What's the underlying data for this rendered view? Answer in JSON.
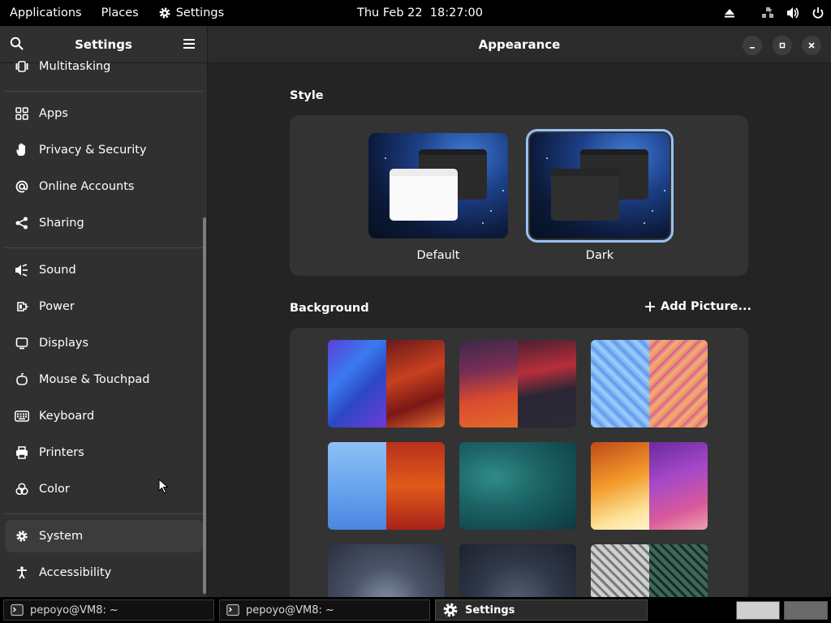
{
  "topbar": {
    "applications": "Applications",
    "places": "Places",
    "settings": "Settings",
    "clock": "Thu Feb 22  18:27:00",
    "tray_icons": [
      "eject-icon",
      "network-icon",
      "volume-icon",
      "power-icon"
    ]
  },
  "sidebar": {
    "title": "Settings",
    "items": [
      {
        "label": "Multitasking",
        "icon": "multitasking-icon"
      },
      {
        "label": "Apps",
        "icon": "apps-icon"
      },
      {
        "label": "Privacy & Security",
        "icon": "hand-icon"
      },
      {
        "label": "Online Accounts",
        "icon": "at-icon"
      },
      {
        "label": "Sharing",
        "icon": "share-icon"
      },
      {
        "label": "Sound",
        "icon": "speaker-icon"
      },
      {
        "label": "Power",
        "icon": "battery-icon"
      },
      {
        "label": "Displays",
        "icon": "display-icon"
      },
      {
        "label": "Mouse & Touchpad",
        "icon": "mouse-icon"
      },
      {
        "label": "Keyboard",
        "icon": "keyboard-icon"
      },
      {
        "label": "Printers",
        "icon": "printer-icon"
      },
      {
        "label": "Color",
        "icon": "color-icon"
      },
      {
        "label": "System",
        "icon": "gear-icon",
        "active": true
      },
      {
        "label": "Accessibility",
        "icon": "accessibility-icon"
      }
    ]
  },
  "main": {
    "title": "Appearance",
    "style_section": "Style",
    "style_options": [
      {
        "label": "Default",
        "selected": false
      },
      {
        "label": "Dark",
        "selected": true
      }
    ],
    "background_section": "Background",
    "add_picture": "Add Picture..."
  },
  "taskbar": {
    "tasks": [
      {
        "label": "pepoyo@VM8: ~"
      },
      {
        "label": "pepoyo@VM8: ~"
      },
      {
        "label": "Settings",
        "active": true
      }
    ]
  },
  "colors": {
    "accent": "#99c1f1",
    "sidebar_bg": "#303030",
    "main_bg": "#242424",
    "card_bg": "#333333"
  }
}
